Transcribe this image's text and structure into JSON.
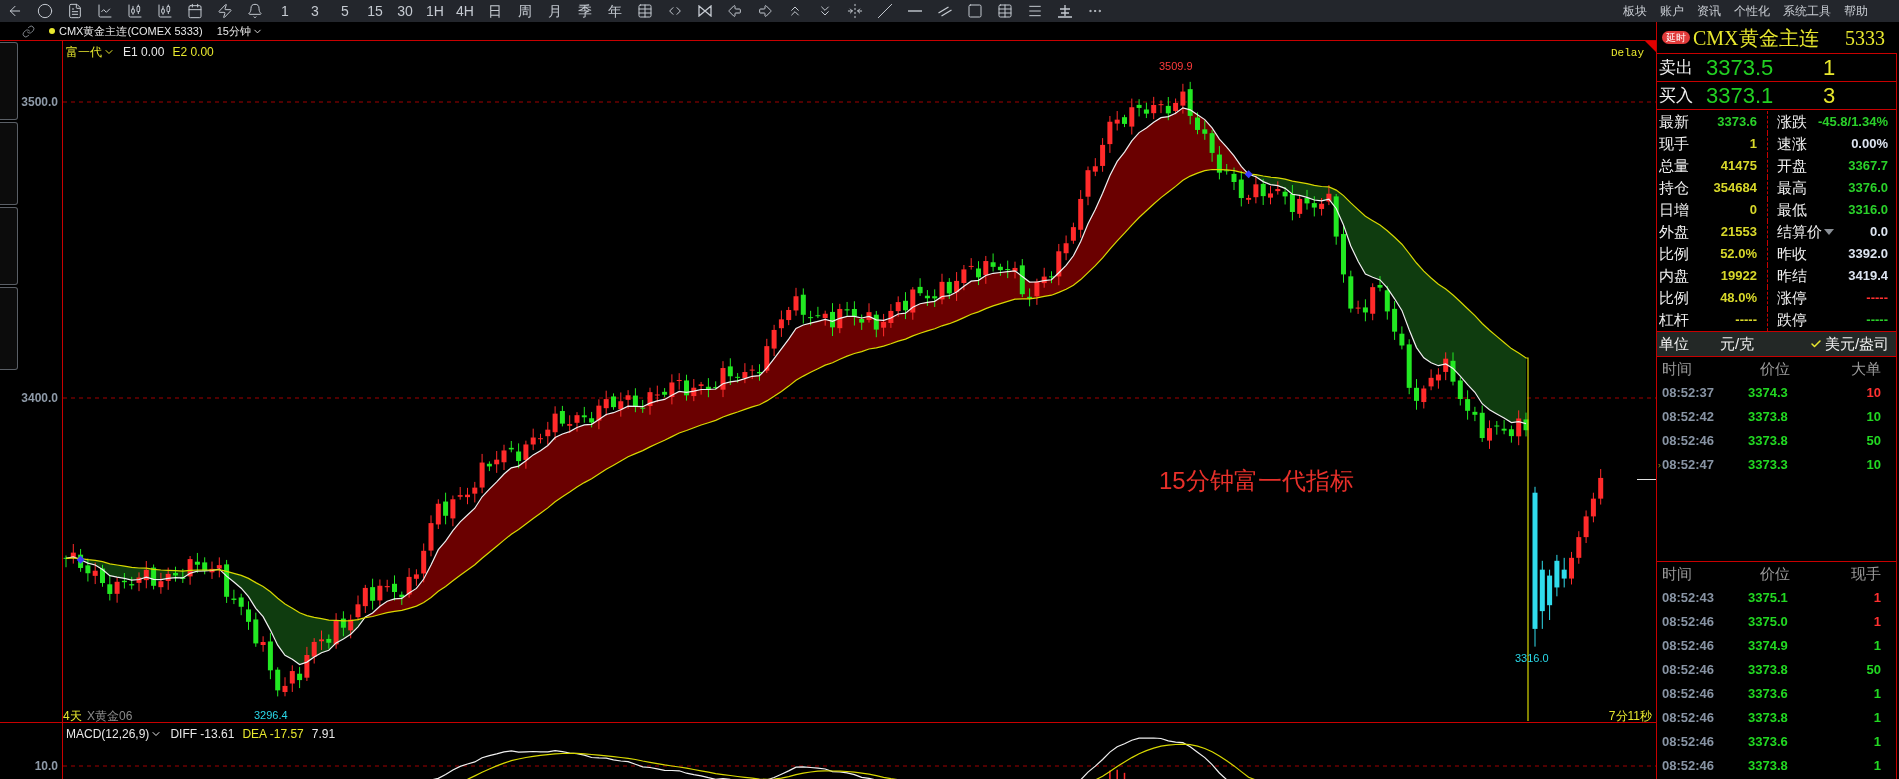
{
  "toolbar": {
    "periods": [
      "1",
      "3",
      "5",
      "15",
      "30",
      "1H",
      "4H",
      "日",
      "周",
      "月",
      "季",
      "年"
    ]
  },
  "menu": [
    "板块",
    "账户",
    "资讯",
    "个性化",
    "系统工具",
    "帮助"
  ],
  "symbol_bar": {
    "symbol": "CMX黄金主连(COMEX 5333)",
    "period": "15分钟"
  },
  "indicator": {
    "name": "富一代",
    "values": [
      {
        "text": "E1 0.00",
        "color": "#e8e8e8"
      },
      {
        "text": "E2 0.00",
        "color": "#e8e82e"
      }
    ]
  },
  "chart": {
    "delay": "Delay",
    "price_labels": [
      "3500.0",
      "3400.0"
    ],
    "high_label": "3509.9",
    "low_label": "3296.4",
    "session_low_label": "3316.0",
    "caption": "15分钟富一代指标",
    "days": "4天",
    "contract": "X黄金06",
    "countdown": "7分11秒"
  },
  "macd": {
    "name": "MACD(12,26,9)",
    "values": [
      {
        "text": "DIFF -13.61",
        "color": "#e8e8e8"
      },
      {
        "text": "DEA -17.57",
        "color": "#e8e82e"
      },
      {
        "text": "7.91",
        "color": "#e8e8e8"
      }
    ],
    "axis_label": "10.0"
  },
  "quote": {
    "badge": "延时",
    "title": "CMX黄金主连",
    "code": "5333",
    "ask": {
      "label": "卖出",
      "price": "3373.5",
      "size": "1"
    },
    "bid": {
      "label": "买入",
      "price": "3373.1",
      "size": "3"
    },
    "stats": [
      {
        "left": {
          "label": "最新",
          "value": "3373.6",
          "color": "#2ad02a"
        },
        "right": {
          "label": "涨跌",
          "value": "-45.8/1.34%",
          "color": "#2ad02a",
          "kind": "plain"
        }
      },
      {
        "left": {
          "label": "现手",
          "value": "1",
          "color": "#d8d82a"
        },
        "right": {
          "label": "速涨",
          "value": "0.00%",
          "color": "#dde4f0",
          "kind": "plain"
        }
      },
      {
        "left": {
          "label": "总量",
          "value": "41475",
          "color": "#d8d82a"
        },
        "right": {
          "label": "开盘",
          "value": "3367.7",
          "color": "#2ad02a",
          "kind": "plain"
        }
      },
      {
        "left": {
          "label": "持仓",
          "value": "354684",
          "color": "#d8d82a"
        },
        "right": {
          "label": "最高",
          "value": "3376.0",
          "color": "#2ad02a",
          "kind": "plain"
        }
      },
      {
        "left": {
          "label": "日增",
          "value": "0",
          "color": "#d8d82a"
        },
        "right": {
          "label": "最低",
          "value": "3316.0",
          "color": "#2ad02a",
          "kind": "plain"
        }
      },
      {
        "left": {
          "label": "外盘",
          "value": "21553",
          "color": "#d8d82a"
        },
        "right": {
          "label": "结算价",
          "value": "0.0",
          "color": "#dde4f0",
          "kind": "dropdown"
        }
      },
      {
        "left": {
          "label": "比例",
          "value": "52.0%",
          "color": "#d8d82a"
        },
        "right": {
          "label": "昨收",
          "value": "3392.0",
          "color": "#dde4f0",
          "kind": "plain"
        }
      },
      {
        "left": {
          "label": "内盘",
          "value": "19922",
          "color": "#d8d82a"
        },
        "right": {
          "label": "昨结",
          "value": "3419.4",
          "color": "#dde4f0",
          "kind": "plain"
        }
      },
      {
        "left": {
          "label": "比例",
          "value": "48.0%",
          "color": "#d8d82a"
        },
        "right": {
          "label": "涨停",
          "value": "-----",
          "color": "#ff3030",
          "kind": "plain"
        }
      },
      {
        "left": {
          "label": "杠杆",
          "value": "-----",
          "color": "#d8d82a"
        },
        "right": {
          "label": "跌停",
          "value": "-----",
          "color": "#2ad02a",
          "kind": "plain"
        }
      }
    ],
    "unit": {
      "label": "单位",
      "options": [
        {
          "label": "元/克",
          "selected": false
        },
        {
          "label": "美元/盎司",
          "selected": true
        }
      ]
    }
  },
  "big_orders": {
    "columns": [
      "时间",
      "价位",
      "大单"
    ],
    "rows": [
      {
        "time": "08:52:37",
        "price": "3374.3",
        "volume": "10",
        "color": "#ff3030",
        "current": false
      },
      {
        "time": "08:52:42",
        "price": "3373.8",
        "volume": "10",
        "color": "#22d822",
        "current": false
      },
      {
        "time": "08:52:46",
        "price": "3373.8",
        "volume": "50",
        "color": "#22d822",
        "current": false
      },
      {
        "time": "08:52:47",
        "price": "3373.3",
        "volume": "10",
        "color": "#22d822",
        "current": true
      }
    ]
  },
  "ticks": {
    "columns": [
      "时间",
      "价位",
      "现手"
    ],
    "rows": [
      {
        "time": "08:52:43",
        "price": "3375.1",
        "volume": "1",
        "color": "#ff3030"
      },
      {
        "time": "08:52:46",
        "price": "3375.0",
        "volume": "1",
        "color": "#ff3030"
      },
      {
        "time": "08:52:46",
        "price": "3374.9",
        "volume": "1",
        "color": "#22d822"
      },
      {
        "time": "08:52:46",
        "price": "3373.8",
        "volume": "50",
        "color": "#22d822"
      },
      {
        "time": "08:52:46",
        "price": "3373.6",
        "volume": "1",
        "color": "#22d822"
      },
      {
        "time": "08:52:46",
        "price": "3373.8",
        "volume": "1",
        "color": "#22d822"
      },
      {
        "time": "08:52:46",
        "price": "3373.6",
        "volume": "1",
        "color": "#22d822"
      },
      {
        "time": "08:52:46",
        "price": "3373.8",
        "volume": "1",
        "color": "#22d822"
      }
    ]
  }
}
